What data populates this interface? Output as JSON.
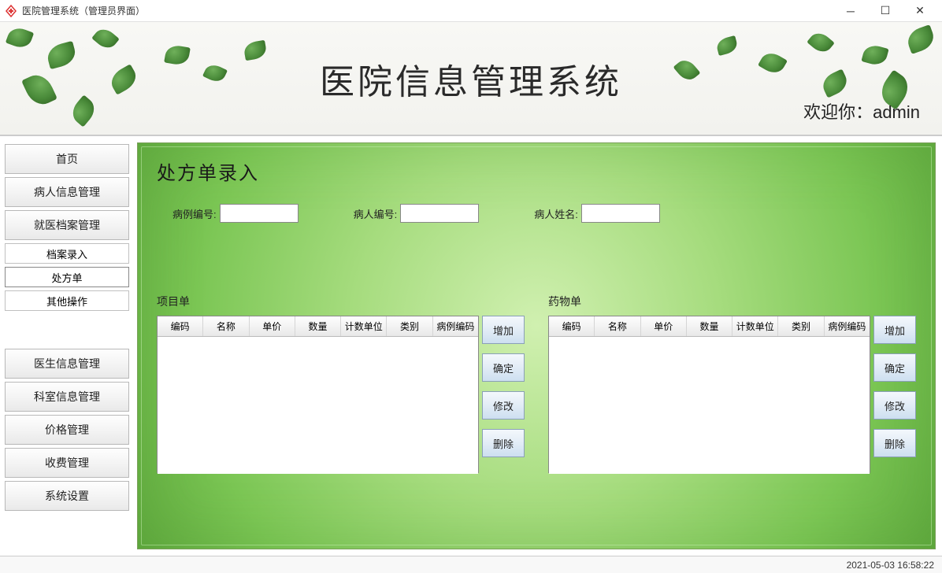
{
  "window": {
    "title": "医院管理系统（管理员界面）"
  },
  "header": {
    "title": "医院信息管理系统",
    "welcome_prefix": "欢迎你：",
    "user": "admin"
  },
  "sidebar": {
    "top": [
      "首页",
      "病人信息管理",
      "就医档案管理"
    ],
    "sub": [
      "档案录入",
      "处方单",
      "其他操作"
    ],
    "bottom": [
      "医生信息管理",
      "科室信息管理",
      "价格管理",
      "收费管理",
      "系统设置"
    ]
  },
  "main": {
    "title": "处方单录入",
    "fields": {
      "record_no": "病例编号:",
      "patient_no": "病人编号:",
      "patient_name": "病人姓名:"
    },
    "values": {
      "record_no": "",
      "patient_no": "",
      "patient_name": ""
    },
    "project_label": "项目单",
    "medicine_label": "药物单",
    "columns": [
      "编码",
      "名称",
      "单价",
      "数量",
      "计数单位",
      "类别",
      "病例编码"
    ],
    "actions": [
      "增加",
      "确定",
      "修改",
      "删除"
    ]
  },
  "status": {
    "datetime": "2021-05-03 16:58:22"
  }
}
